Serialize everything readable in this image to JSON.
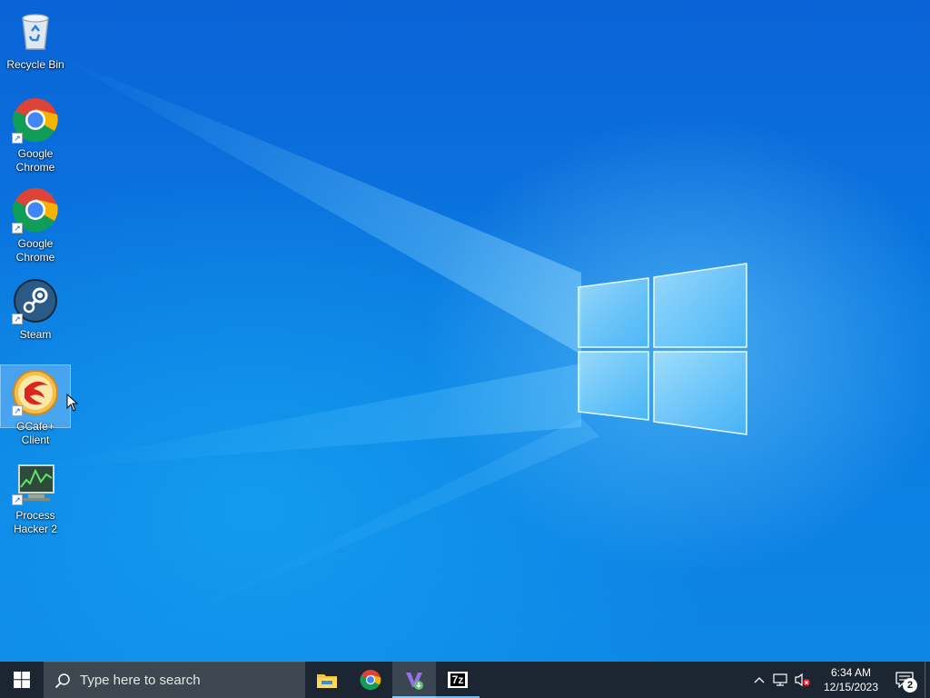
{
  "desktop": {
    "icons": [
      {
        "label": "Recycle Bin"
      },
      {
        "label": "Google Chrome"
      },
      {
        "label": "Google Chrome"
      },
      {
        "label": "Steam"
      },
      {
        "label": "GCafe+ Client"
      },
      {
        "label": "Process Hacker 2"
      }
    ]
  },
  "taskbar": {
    "search_placeholder": "Type here to search",
    "apps": [
      {
        "icon": "file-explorer-icon"
      },
      {
        "icon": "chrome-icon"
      },
      {
        "icon": "visual-studio-installer-icon"
      },
      {
        "icon": "7zip-icon",
        "label": "7z"
      }
    ],
    "tray": {
      "time": "6:34 AM",
      "date": "12/15/2023",
      "notification_count": "2"
    }
  },
  "colors": {
    "taskbar_bg": "#1c2632",
    "search_bg": "#3e4750",
    "accent": "#76b9ed"
  }
}
